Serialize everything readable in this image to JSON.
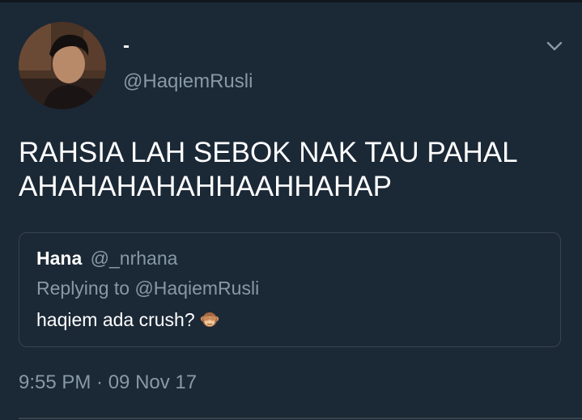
{
  "author": {
    "display_name": "-",
    "handle": "@HaqiemRusli"
  },
  "tweet": {
    "text": "RAHSIA LAH SEBOK NAK TAU PAHAL AHAHAHAHAHHAAHHAHAP",
    "timestamp": "9:55 PM · 09 Nov 17"
  },
  "quoted_tweet": {
    "name": "Hana",
    "handle": "@_nrhana",
    "replying_to": "Replying to @HaqiemRusli",
    "text": "haqiem ada crush?",
    "emoji": "see-no-evil-monkey-icon"
  },
  "icons": {
    "menu": "chevron-down-icon"
  },
  "colors": {
    "background": "#1b2836",
    "primary_text": "#ffffff",
    "secondary_text": "#8899a6",
    "border": "#38444d"
  }
}
